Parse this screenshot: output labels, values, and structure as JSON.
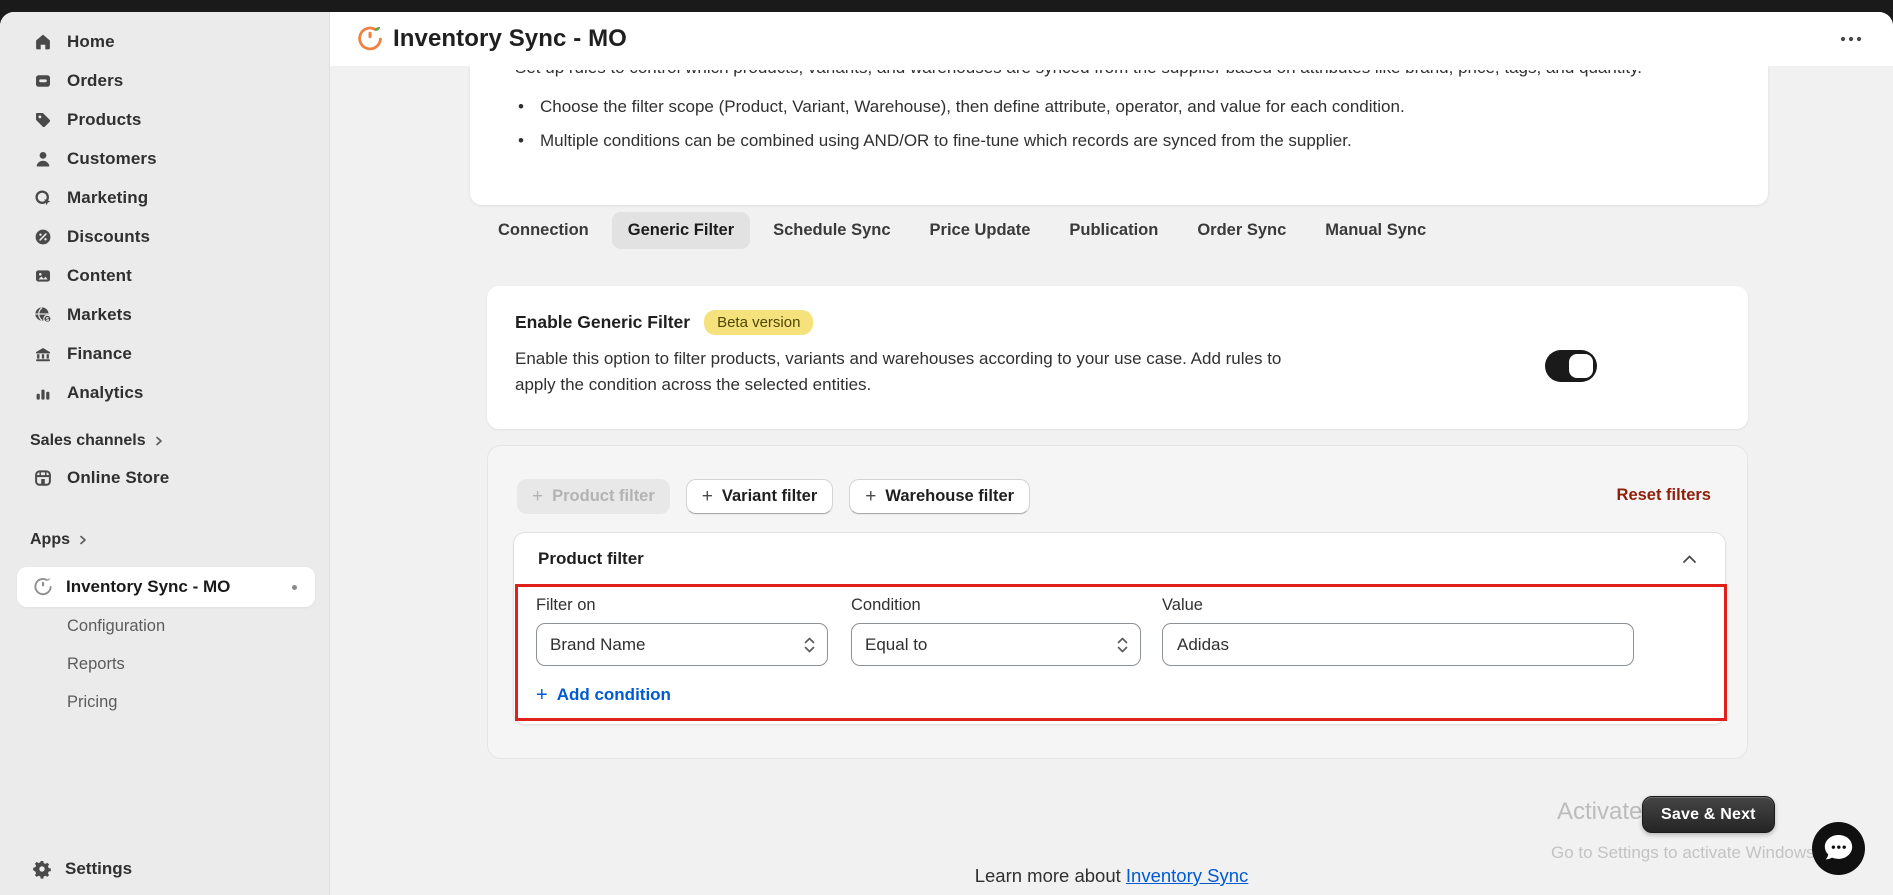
{
  "sidebar": {
    "items": [
      {
        "label": "Home",
        "icon": "home-icon"
      },
      {
        "label": "Orders",
        "icon": "orders-icon"
      },
      {
        "label": "Products",
        "icon": "products-icon"
      },
      {
        "label": "Customers",
        "icon": "customers-icon"
      },
      {
        "label": "Marketing",
        "icon": "marketing-icon"
      },
      {
        "label": "Discounts",
        "icon": "discounts-icon"
      },
      {
        "label": "Content",
        "icon": "content-icon"
      },
      {
        "label": "Markets",
        "icon": "markets-icon"
      },
      {
        "label": "Finance",
        "icon": "finance-icon"
      },
      {
        "label": "Analytics",
        "icon": "analytics-icon"
      }
    ],
    "sales_channels_label": "Sales channels",
    "online_store_label": "Online Store",
    "apps_label": "Apps",
    "app_item": {
      "label": "Inventory Sync - MO",
      "icon": "sync-gauge-icon"
    },
    "app_subitems": [
      {
        "label": "Configuration"
      },
      {
        "label": "Reports"
      },
      {
        "label": "Pricing"
      }
    ],
    "settings_label": "Settings"
  },
  "header": {
    "title": "Inventory Sync - MO",
    "menu_icon": "ellipsis-icon"
  },
  "info_card": {
    "clipped_line": "Set up rules to control which products, variants, and warehouses are synced from the supplier based on attributes like brand, price, tags, and quantity.",
    "bullets": [
      "Choose the filter scope (Product, Variant, Warehouse), then define attribute, operator, and value for each condition.",
      "Multiple conditions can be combined using AND/OR to fine-tune which records are synced from the supplier."
    ]
  },
  "tabs": {
    "items": [
      "Connection",
      "Generic Filter",
      "Schedule Sync",
      "Price Update",
      "Publication",
      "Order Sync",
      "Manual Sync"
    ],
    "active": "Generic Filter"
  },
  "generic_filter": {
    "title": "Enable Generic Filter",
    "badge": "Beta version",
    "description": "Enable this option to filter products, variants and warehouses according to your use case. Add rules to apply the condition across the selected entities.",
    "toggle_state": "on"
  },
  "filters_toolbar": {
    "product_filter_label": "Product filter",
    "product_filter_enabled": false,
    "variant_filter_label": "Variant filter",
    "warehouse_filter_label": "Warehouse filter",
    "reset_label": "Reset filters"
  },
  "product_filter_card": {
    "title": "Product filter",
    "fields": [
      {
        "label": "Filter on",
        "value": "Brand Name",
        "type": "select"
      },
      {
        "label": "Condition",
        "value": "Equal to",
        "type": "select"
      },
      {
        "label": "Value",
        "value": "Adidas",
        "type": "text"
      }
    ],
    "add_condition_label": "Add condition"
  },
  "actions": {
    "save_label": "Save & Next"
  },
  "watermark": {
    "line1": "Activate Windows",
    "line2": "Go to Settings to activate Windows."
  },
  "footer": {
    "learn_more_prefix": "Learn more about",
    "learn_more_link": "Inventory Sync"
  },
  "colors": {
    "page_bg": "#f1f1f1",
    "sidebar_bg": "#ebebeb",
    "link": "#005bd3",
    "critical_link": "#8e1f0b",
    "highlight_border": "#e0201a",
    "badge_bg": "#f5e27d",
    "toggle_on": "#1a1a1a",
    "brand_orange": "#ef8243",
    "leaf_green": "#58a942"
  }
}
